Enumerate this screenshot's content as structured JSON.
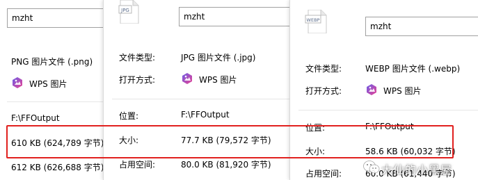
{
  "panel1": {
    "filename": "mzht",
    "file_type": "PNG 图片文件 (.png)",
    "open_with": "WPS 图片",
    "location": "F:\\FFOutput",
    "size": "610 KB (624,789 字节)",
    "size_on_disk": "612 KB (626,688 字节)"
  },
  "panel2": {
    "icon_label": "JPG",
    "filename": "mzht",
    "file_type_label": "文件类型:",
    "file_type": "JPG 图片文件 (.jpg)",
    "open_with_label": "打开方式:",
    "open_with": "WPS 图片",
    "location_label": "位置:",
    "location": "F:\\FFOutput",
    "size_label": "大小:",
    "size": "77.7 KB (79,572 字节)",
    "size_on_disk_label": "占用空间:",
    "size_on_disk": "80.0 KB (81,920 字节)"
  },
  "panel3": {
    "icon_label": "WEBP",
    "filename": "mzht",
    "file_type_label": "文件类型:",
    "file_type": "WEBP 图片文件 (.webp)",
    "open_with_label": "打开方式:",
    "open_with": "WPS 图片",
    "location_label": "位置:",
    "location": "F:\\FFOutput",
    "size_label": "大小:",
    "size": "58.6 KB (60,032 字节)",
    "size_on_disk_label": "占用空间:",
    "size_on_disk": "60.0 KB (61,440 字节)"
  },
  "watermark": {
    "text": "大仙的小黑屋"
  },
  "colors": {
    "highlight": "#e1201e",
    "wps_icon_start": "#6c5ce7",
    "wps_icon_end": "#e84393"
  }
}
